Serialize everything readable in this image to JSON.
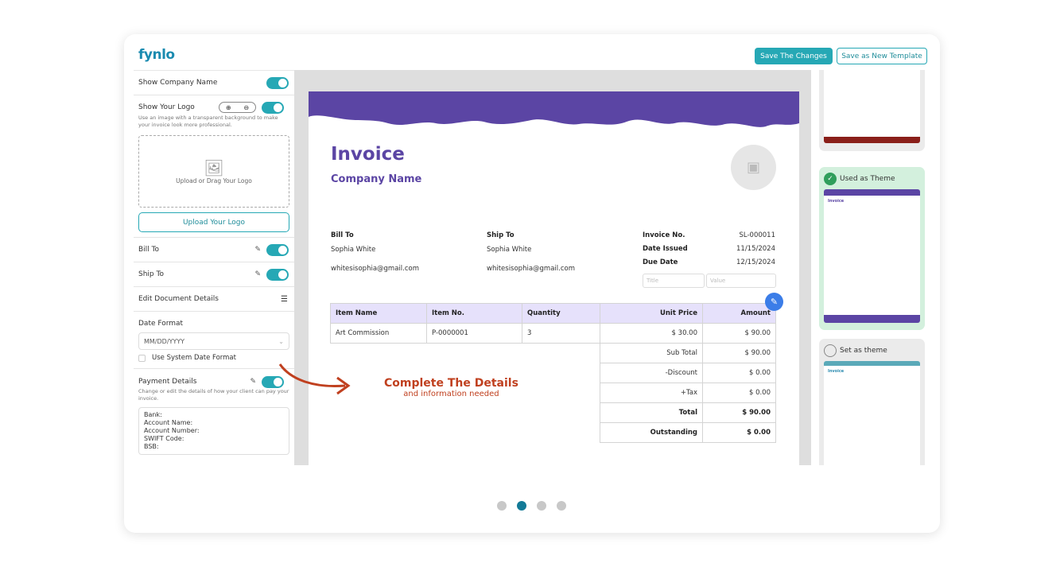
{
  "header": {
    "logo": "fynlo",
    "save_changes": "Save The Changes",
    "save_template": "Save as New Template"
  },
  "sidebar": {
    "show_company_name": "Show Company Name",
    "show_logo": "Show Your Logo",
    "logo_hint": "Use an image with a transparent background to make your invoice look more professional.",
    "upload_drag": "Upload or Drag Your Logo",
    "upload_button": "Upload Your Logo",
    "bill_to": "Bill To",
    "ship_to": "Ship To",
    "edit_details": "Edit Document Details",
    "date_format_label": "Date Format",
    "date_format_value": "MM/DD/YYYY",
    "system_date": "Use System Date Format",
    "payment_details": "Payment Details",
    "payment_hint": "Change or edit the details of how your client can pay your invoice.",
    "payment_lines": [
      "Bank:",
      "Account Name:",
      "Account Number:",
      "SWIFT Code:",
      "BSB:"
    ]
  },
  "invoice": {
    "title": "Invoice",
    "company": "Company Name",
    "bill_to_label": "Bill To",
    "bill_to_name": "Sophia White",
    "bill_to_email": "whitesisophia@gmail.com",
    "ship_to_label": "Ship To",
    "ship_to_name": "Sophia White",
    "ship_to_email": "whitesisophia@gmail.com",
    "meta": [
      {
        "label": "Invoice No.",
        "value": "SL-000011"
      },
      {
        "label": "Date Issued",
        "value": "11/15/2024"
      },
      {
        "label": "Due Date",
        "value": "12/15/2024"
      }
    ],
    "title_placeholder": "Title",
    "value_placeholder": "Value",
    "columns": [
      "Item Name",
      "Item No.",
      "Quantity",
      "Unit Price",
      "Amount"
    ],
    "rows": [
      [
        "Art Commission",
        "P-0000001",
        "3",
        "$ 30.00",
        "$ 90.00"
      ]
    ],
    "totals": [
      {
        "label": "Sub Total",
        "value": "$ 90.00"
      },
      {
        "label": "-Discount",
        "value": "$ 0.00"
      },
      {
        "label": "+Tax",
        "value": "$ 0.00"
      },
      {
        "label": "Total",
        "value": "$ 90.00"
      },
      {
        "label": "Outstanding",
        "value": "$ 0.00"
      }
    ],
    "accent": "#5b45a4"
  },
  "callout": {
    "title": "Complete The Details",
    "subtitle": "and information needed",
    "color": "#c0401f"
  },
  "themes": {
    "used": "Used as Theme",
    "set": "Set as theme"
  },
  "pagination": {
    "total": 4,
    "active": 2
  }
}
